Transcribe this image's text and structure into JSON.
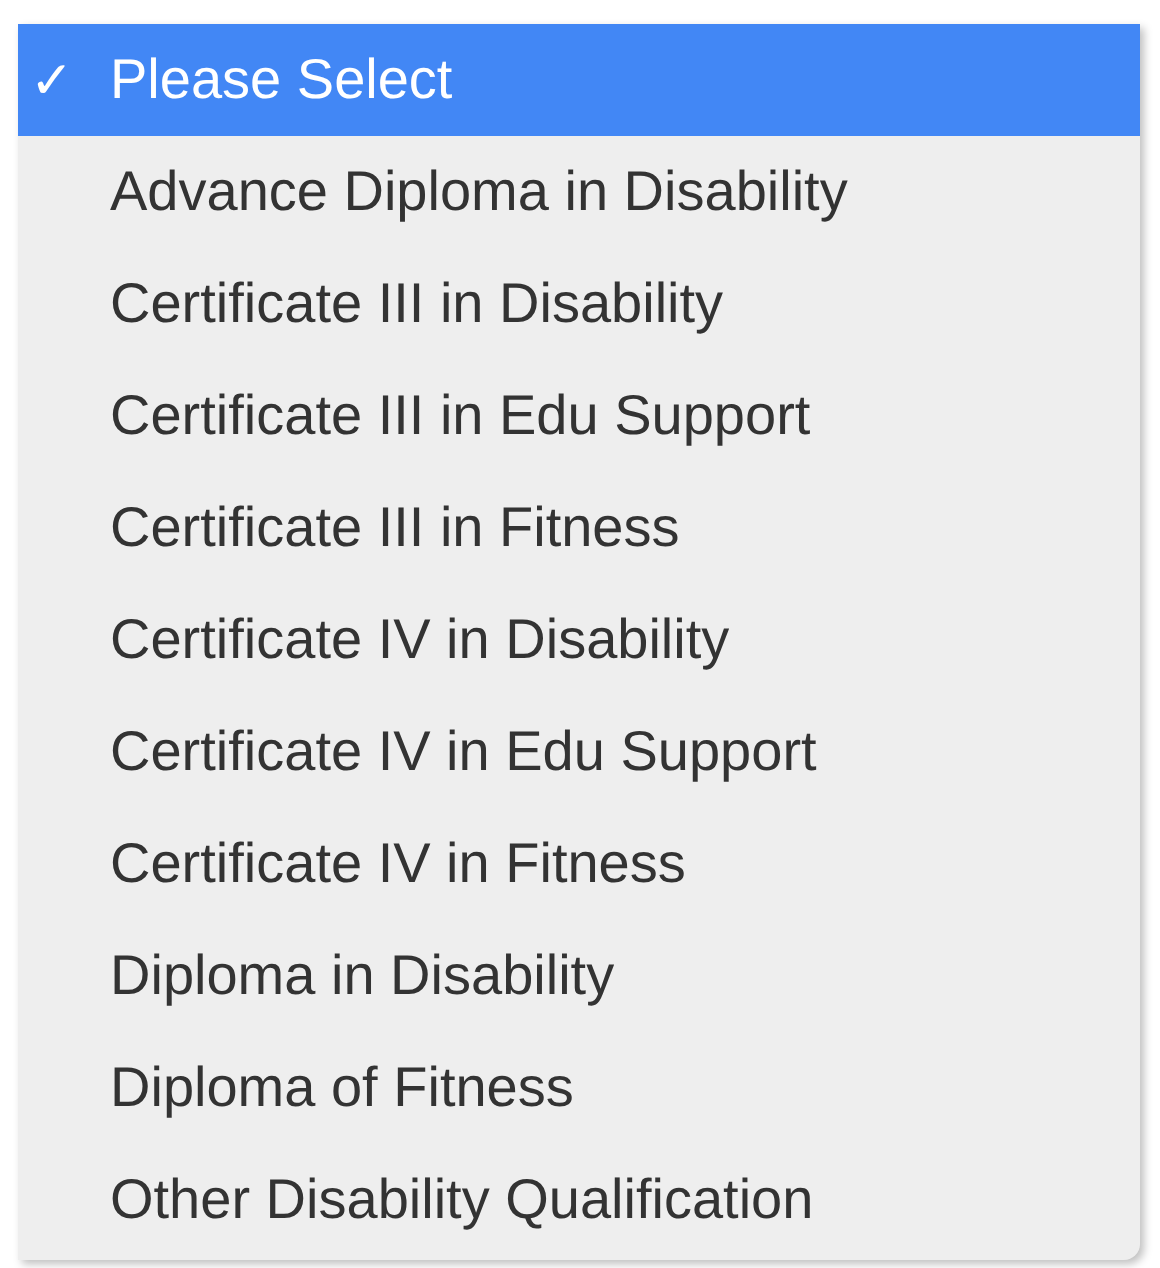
{
  "menu": {
    "check_mark": "✓",
    "items": [
      {
        "label": "Please Select",
        "selected": true
      },
      {
        "label": "Advance Diploma in Disability",
        "selected": false
      },
      {
        "label": "Certificate III in Disability",
        "selected": false
      },
      {
        "label": "Certificate III in Edu Support",
        "selected": false
      },
      {
        "label": "Certificate III in Fitness",
        "selected": false
      },
      {
        "label": "Certificate IV in Disability",
        "selected": false
      },
      {
        "label": "Certificate IV in Edu Support",
        "selected": false
      },
      {
        "label": "Certificate IV in Fitness",
        "selected": false
      },
      {
        "label": "Diploma in Disability",
        "selected": false
      },
      {
        "label": "Diploma of Fitness",
        "selected": false
      },
      {
        "label": "Other Disability Qualification",
        "selected": false
      }
    ]
  }
}
